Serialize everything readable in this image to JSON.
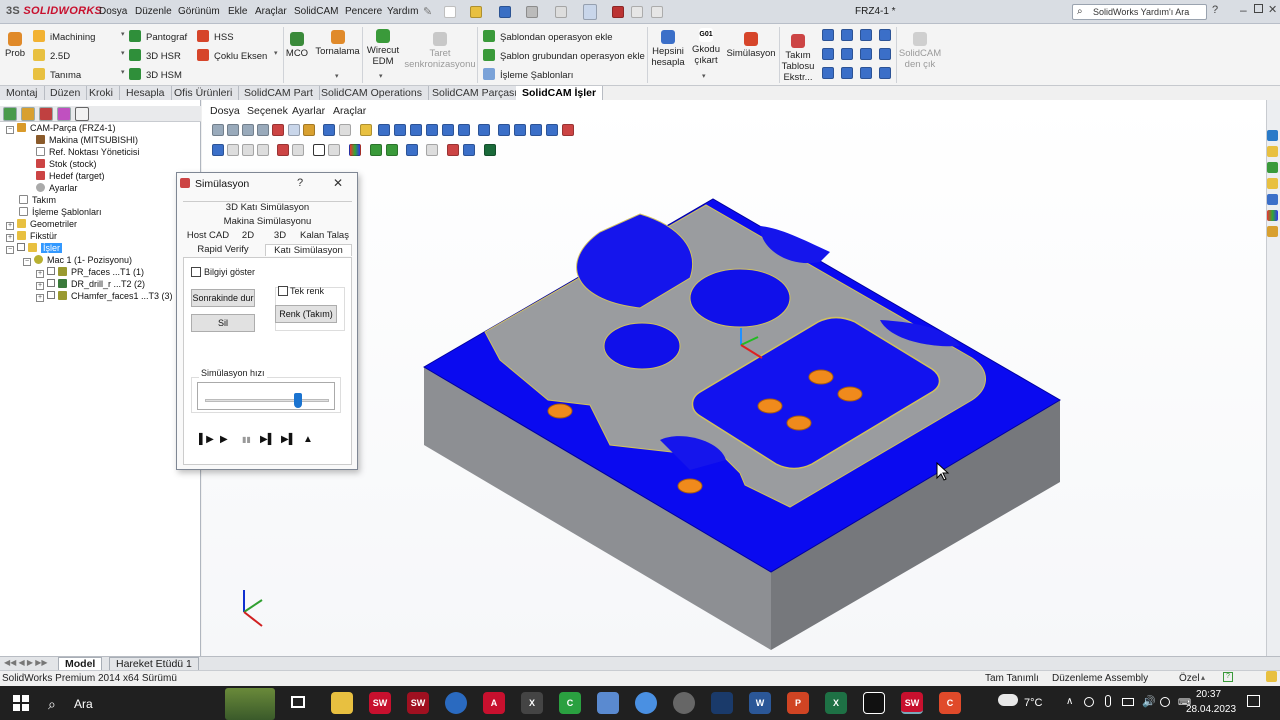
{
  "titlebar": {
    "brand_prefix": "3S",
    "brand": "SOLIDWORKS",
    "menus": [
      "Dosya",
      "Düzenle",
      "Görünüm",
      "Ekle",
      "Araçlar",
      "SolidCAM",
      "Pencere",
      "Yardım"
    ],
    "document_title": "FRZ4-1 *",
    "search_placeholder": "SolidWorks Yardım'ı Ara"
  },
  "commands": {
    "prob": "Prob",
    "imachining": "iMachining",
    "d25": "2.5D",
    "tanima": "Tanıma",
    "pantograf": "Pantograf",
    "hsr": "3D HSR",
    "hsm": "3D HSM",
    "hss": "HSS",
    "coklu": "Çoklu Eksen",
    "mco": "MCO",
    "tornalama": "Tornalama",
    "wirecut": [
      "Wirecut",
      "EDM"
    ],
    "taret": [
      "Taret",
      "senkronizasyonu"
    ],
    "sablon1": "Şablondan operasyon ekle",
    "sablon2": "Şablon grubundan operasyon ekle",
    "isleme_sablonlari": "İşleme Şablonları",
    "hepsini": [
      "Hepsini",
      "hesapla"
    ],
    "gkodu_icon_label": "G01",
    "gkodu": [
      "Gkodu",
      "çıkart"
    ],
    "simulasyon": "Simülasyon",
    "takim": [
      "Takım",
      "Tablosu",
      "Ekstr..."
    ],
    "solidcam_exit": [
      "SolidCAM",
      "den çık"
    ]
  },
  "tabs": [
    "Montaj",
    "Düzen",
    "Kroki",
    "Hesapla",
    "Ofis Ürünleri",
    "SolidCAM Part",
    "SolidCAM Operations",
    "SolidCAM Parçası",
    "SolidCAM İşler"
  ],
  "tree": {
    "root": "CAM-Parça (FRZ4-1)",
    "makina": "Makina (MITSUBISHI)",
    "ref": "Ref. Noktası Yöneticisi",
    "stok": "Stok (stock)",
    "hedef": "Hedef (target)",
    "ayarlar": "Ayarlar",
    "takim": "Takım",
    "isleme": "İşleme Şablonları",
    "geometriler": "Geometriler",
    "fikstur": "Fikstür",
    "isler": "İşler",
    "mac": "Mac 1 (1- Pozisyonu)",
    "op1": "PR_faces ...T1 (1)",
    "op2": "DR_drill_r ...T2 (2)",
    "op3": "CHamfer_faces1 ...T3 (3)"
  },
  "viewport_menu": [
    "Dosya",
    "Seçenek",
    "Ayarlar",
    "Araçlar"
  ],
  "dialog": {
    "title": "Simülasyon",
    "help": "?",
    "close": "✕",
    "tab_3d_kati": "3D Katı Simülasyon",
    "tab_makina": "Makina Simülasyonu",
    "tab_host": "Host CAD",
    "tab_2d": "2D",
    "tab_3d": "3D",
    "tab_kalan": "Kalan Talaş",
    "tab_rapid": "Rapid Verify",
    "tab_kati": "Katı Simülasyon",
    "bilgi": "Bilgiyi göster",
    "tek_renk": "Tek renk",
    "sonrakinde": "Sonrakinde dur",
    "renk": "Renk (Takım)",
    "sil": "Sil",
    "hiz_label": "Simülasyon hızı",
    "speed_fraction": 0.75
  },
  "bottom_tabs": [
    "Model",
    "Hareket Etüdü 1"
  ],
  "status": {
    "left": "SolidWorks Premium 2014 x64 Sürümü",
    "tam": "Tam Tanımlı",
    "duzenleme": "Düzenleme Assembly",
    "ozel": "Özel"
  },
  "taskbar": {
    "search": "Ara",
    "temp": "7°C",
    "time": "20:37",
    "date": "28.04.2023"
  },
  "colors": {
    "accent_blue": "#0a0aff",
    "part_gray": "#8f9194",
    "hole_orange": "#f08a1c"
  }
}
